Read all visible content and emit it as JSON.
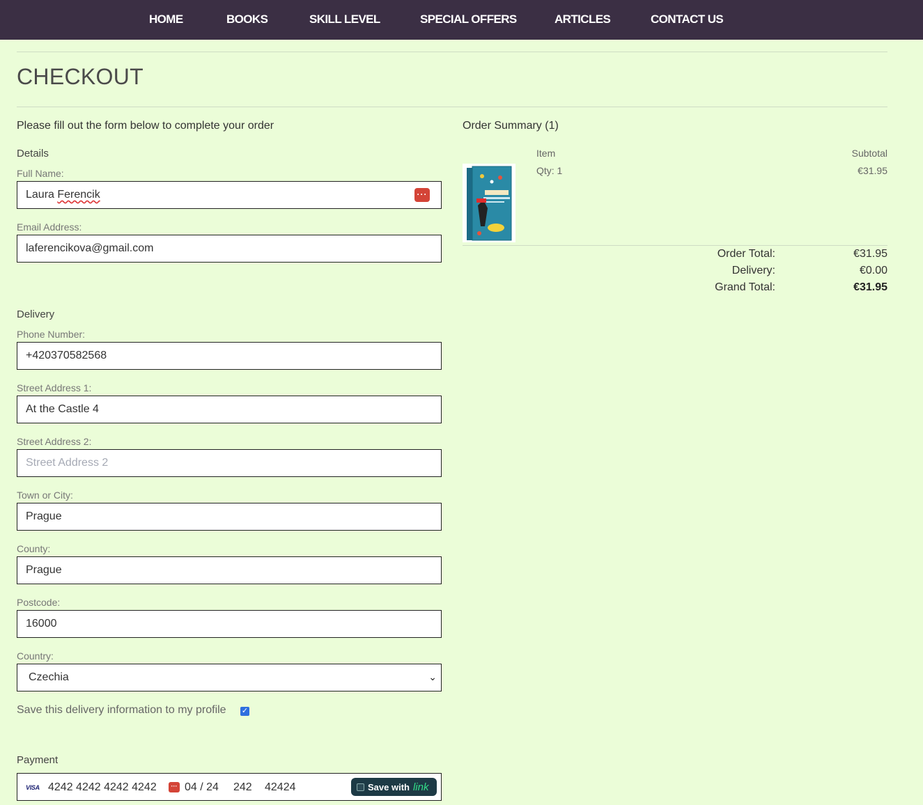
{
  "nav": {
    "items": [
      "HOME",
      "BOOKS",
      "SKILL LEVEL",
      "SPECIAL OFFERS",
      "ARTICLES",
      "CONTACT US"
    ]
  },
  "page": {
    "title": "CHECKOUT",
    "intro": "Please fill out the form below to complete your order"
  },
  "details": {
    "section_label": "Details",
    "full_name": {
      "label": "Full Name:",
      "value_first": "Laura",
      "value_last": "Ferencik"
    },
    "email": {
      "label": "Email Address:",
      "value": "laferencikova@gmail.com"
    }
  },
  "delivery": {
    "section_label": "Delivery",
    "phone": {
      "label": "Phone Number:",
      "value": "+420370582568"
    },
    "street1": {
      "label": "Street Address 1:",
      "value": "At the Castle 4"
    },
    "street2": {
      "label": "Street Address 2:",
      "placeholder": "Street Address 2"
    },
    "town": {
      "label": "Town or City:",
      "value": "Prague"
    },
    "county": {
      "label": "County:",
      "value": "Prague"
    },
    "postcode": {
      "label": "Postcode:",
      "value": "16000"
    },
    "country": {
      "label": "Country:",
      "value": "Czechia"
    },
    "save_info": {
      "label": "Save this delivery information to my profile",
      "checked": true
    }
  },
  "payment": {
    "section_label": "Payment",
    "card_brand": "VISA",
    "card_number": "4242 4242 4242 4242",
    "expiry": "04 / 24",
    "cvc": "242",
    "zip": "42424",
    "link_button_text": "Save with",
    "link_brand": "link"
  },
  "order_summary": {
    "title": "Order Summary (1)",
    "col_item": "Item",
    "col_subtotal": "Subtotal",
    "items": [
      {
        "qty": "Qty: 1",
        "subtotal": "€31.95",
        "image": "book-cover-image"
      }
    ],
    "order_total_label": "Order Total:",
    "order_total": "€31.95",
    "delivery_label": "Delivery:",
    "delivery": "€0.00",
    "grand_total_label": "Grand Total:",
    "grand_total": "€31.95"
  },
  "colors": {
    "navbar": "#3b2f44",
    "background": "#ebfdd8",
    "link_button": "#1d3a45",
    "checkbox": "#2f6fdf"
  }
}
